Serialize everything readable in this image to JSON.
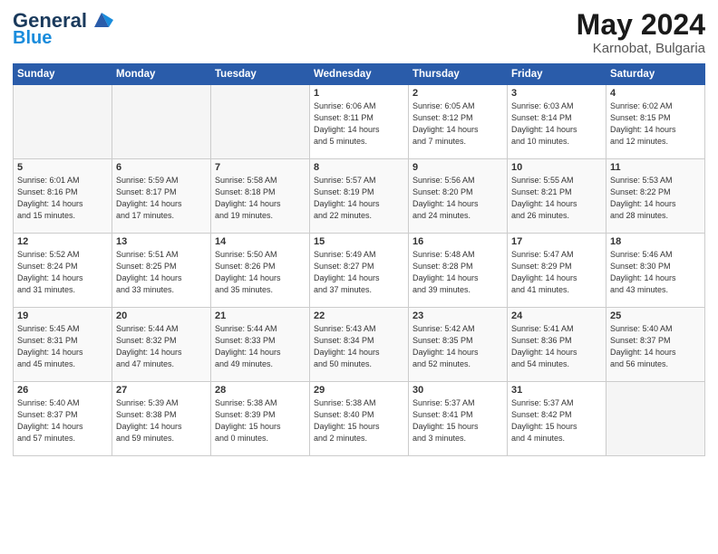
{
  "logo": {
    "name": "General",
    "name2": "Blue"
  },
  "title": "May 2024",
  "location": "Karnobat, Bulgaria",
  "days_of_week": [
    "Sunday",
    "Monday",
    "Tuesday",
    "Wednesday",
    "Thursday",
    "Friday",
    "Saturday"
  ],
  "weeks": [
    [
      {
        "num": "",
        "info": ""
      },
      {
        "num": "",
        "info": ""
      },
      {
        "num": "",
        "info": ""
      },
      {
        "num": "1",
        "info": "Sunrise: 6:06 AM\nSunset: 8:11 PM\nDaylight: 14 hours\nand 5 minutes."
      },
      {
        "num": "2",
        "info": "Sunrise: 6:05 AM\nSunset: 8:12 PM\nDaylight: 14 hours\nand 7 minutes."
      },
      {
        "num": "3",
        "info": "Sunrise: 6:03 AM\nSunset: 8:14 PM\nDaylight: 14 hours\nand 10 minutes."
      },
      {
        "num": "4",
        "info": "Sunrise: 6:02 AM\nSunset: 8:15 PM\nDaylight: 14 hours\nand 12 minutes."
      }
    ],
    [
      {
        "num": "5",
        "info": "Sunrise: 6:01 AM\nSunset: 8:16 PM\nDaylight: 14 hours\nand 15 minutes."
      },
      {
        "num": "6",
        "info": "Sunrise: 5:59 AM\nSunset: 8:17 PM\nDaylight: 14 hours\nand 17 minutes."
      },
      {
        "num": "7",
        "info": "Sunrise: 5:58 AM\nSunset: 8:18 PM\nDaylight: 14 hours\nand 19 minutes."
      },
      {
        "num": "8",
        "info": "Sunrise: 5:57 AM\nSunset: 8:19 PM\nDaylight: 14 hours\nand 22 minutes."
      },
      {
        "num": "9",
        "info": "Sunrise: 5:56 AM\nSunset: 8:20 PM\nDaylight: 14 hours\nand 24 minutes."
      },
      {
        "num": "10",
        "info": "Sunrise: 5:55 AM\nSunset: 8:21 PM\nDaylight: 14 hours\nand 26 minutes."
      },
      {
        "num": "11",
        "info": "Sunrise: 5:53 AM\nSunset: 8:22 PM\nDaylight: 14 hours\nand 28 minutes."
      }
    ],
    [
      {
        "num": "12",
        "info": "Sunrise: 5:52 AM\nSunset: 8:24 PM\nDaylight: 14 hours\nand 31 minutes."
      },
      {
        "num": "13",
        "info": "Sunrise: 5:51 AM\nSunset: 8:25 PM\nDaylight: 14 hours\nand 33 minutes."
      },
      {
        "num": "14",
        "info": "Sunrise: 5:50 AM\nSunset: 8:26 PM\nDaylight: 14 hours\nand 35 minutes."
      },
      {
        "num": "15",
        "info": "Sunrise: 5:49 AM\nSunset: 8:27 PM\nDaylight: 14 hours\nand 37 minutes."
      },
      {
        "num": "16",
        "info": "Sunrise: 5:48 AM\nSunset: 8:28 PM\nDaylight: 14 hours\nand 39 minutes."
      },
      {
        "num": "17",
        "info": "Sunrise: 5:47 AM\nSunset: 8:29 PM\nDaylight: 14 hours\nand 41 minutes."
      },
      {
        "num": "18",
        "info": "Sunrise: 5:46 AM\nSunset: 8:30 PM\nDaylight: 14 hours\nand 43 minutes."
      }
    ],
    [
      {
        "num": "19",
        "info": "Sunrise: 5:45 AM\nSunset: 8:31 PM\nDaylight: 14 hours\nand 45 minutes."
      },
      {
        "num": "20",
        "info": "Sunrise: 5:44 AM\nSunset: 8:32 PM\nDaylight: 14 hours\nand 47 minutes."
      },
      {
        "num": "21",
        "info": "Sunrise: 5:44 AM\nSunset: 8:33 PM\nDaylight: 14 hours\nand 49 minutes."
      },
      {
        "num": "22",
        "info": "Sunrise: 5:43 AM\nSunset: 8:34 PM\nDaylight: 14 hours\nand 50 minutes."
      },
      {
        "num": "23",
        "info": "Sunrise: 5:42 AM\nSunset: 8:35 PM\nDaylight: 14 hours\nand 52 minutes."
      },
      {
        "num": "24",
        "info": "Sunrise: 5:41 AM\nSunset: 8:36 PM\nDaylight: 14 hours\nand 54 minutes."
      },
      {
        "num": "25",
        "info": "Sunrise: 5:40 AM\nSunset: 8:37 PM\nDaylight: 14 hours\nand 56 minutes."
      }
    ],
    [
      {
        "num": "26",
        "info": "Sunrise: 5:40 AM\nSunset: 8:37 PM\nDaylight: 14 hours\nand 57 minutes."
      },
      {
        "num": "27",
        "info": "Sunrise: 5:39 AM\nSunset: 8:38 PM\nDaylight: 14 hours\nand 59 minutes."
      },
      {
        "num": "28",
        "info": "Sunrise: 5:38 AM\nSunset: 8:39 PM\nDaylight: 15 hours\nand 0 minutes."
      },
      {
        "num": "29",
        "info": "Sunrise: 5:38 AM\nSunset: 8:40 PM\nDaylight: 15 hours\nand 2 minutes."
      },
      {
        "num": "30",
        "info": "Sunrise: 5:37 AM\nSunset: 8:41 PM\nDaylight: 15 hours\nand 3 minutes."
      },
      {
        "num": "31",
        "info": "Sunrise: 5:37 AM\nSunset: 8:42 PM\nDaylight: 15 hours\nand 4 minutes."
      },
      {
        "num": "",
        "info": ""
      }
    ]
  ]
}
